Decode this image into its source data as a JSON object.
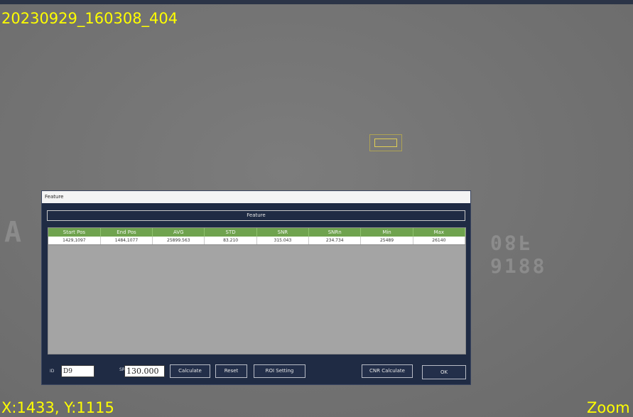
{
  "viewer": {
    "image_name": "20230929_160308_404",
    "cursor_position": "X:1433, Y:1115",
    "zoom_label": "Zoom",
    "ghost_left": "A",
    "ghost_line1": "08F",
    "ghost_line2": "9188"
  },
  "dialog": {
    "title": "Feature",
    "section_header": "Feature",
    "table": {
      "columns": [
        "Start Pos",
        "End Pos",
        "AVG",
        "STD",
        "SNR",
        "SNRn",
        "Min",
        "Max"
      ],
      "rows": [
        [
          "1429,1097",
          "1484,1077",
          "25899.563",
          "83.210",
          "315.043",
          "234.734",
          "25489",
          "26140"
        ]
      ]
    },
    "id_label": "ID",
    "id_value": "D9",
    "srb_label": "SRb(um)",
    "srb_value": "130.000",
    "buttons": {
      "calculate": "Calculate",
      "reset": "Reset",
      "roi_setting": "ROI Setting",
      "cnr_calculate": "CNR Calculate",
      "ok": "OK"
    }
  },
  "colors": {
    "overlay_text": "#ffff00",
    "dialog_bg": "#1f2b44",
    "table_header": "#6fa34e",
    "grid_empty": "#a4a4a4"
  }
}
